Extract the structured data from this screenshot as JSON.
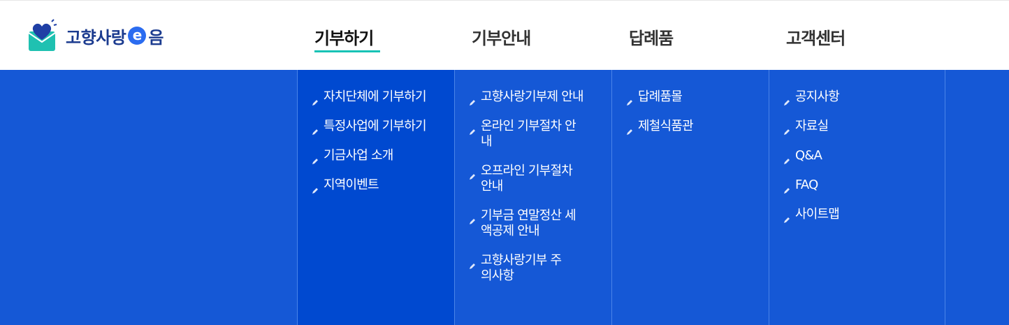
{
  "brand": {
    "name_part1": "고향사랑",
    "name_e": "e",
    "name_part2": "음"
  },
  "gnb": [
    {
      "label": "기부하기",
      "active": true
    },
    {
      "label": "기부안내",
      "active": false
    },
    {
      "label": "답례품",
      "active": false
    },
    {
      "label": "고객센터",
      "active": false
    }
  ],
  "menus": {
    "donate": [
      "자치단체에 기부하기",
      "특정사업에 기부하기",
      "기금사업 소개",
      "지역이벤트"
    ],
    "guide": [
      "고향사랑기부제 안내",
      "온라인 기부절차 안내",
      "오프라인 기부절차 안내",
      "기부금 연말정산 세액공제 안내",
      "고향사랑기부 주의사항"
    ],
    "gift": [
      "답례품몰",
      "제철식품관"
    ],
    "support": [
      "공지사항",
      "자료실",
      "Q&A",
      "FAQ",
      "사이트맵"
    ]
  },
  "colors": {
    "accent_underline": "#18c3b6",
    "mega_bg": "#1558d6",
    "active_col_bg": "#0049d0",
    "brand_blue": "#1b3b8f"
  },
  "icons": {
    "bullet": "pencil-icon",
    "logo": "heart-envelope-logo"
  }
}
